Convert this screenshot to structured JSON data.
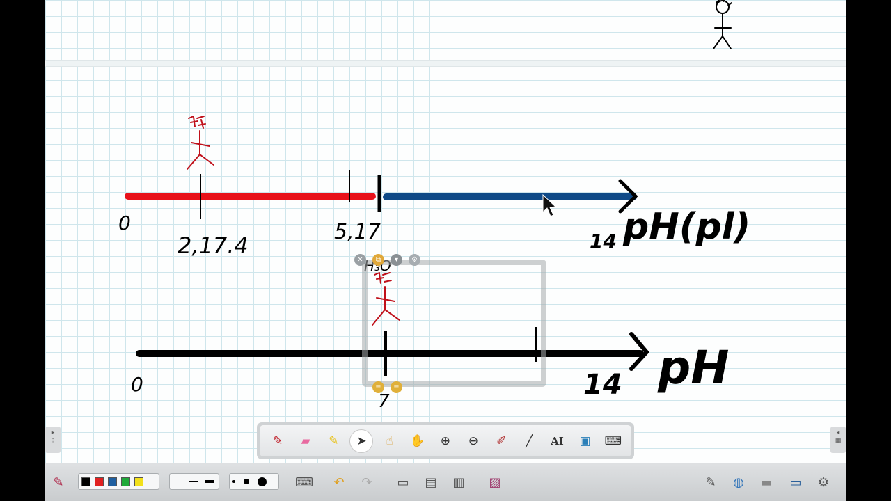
{
  "ink": {
    "lower_figure_labels": [
      "H₃O"
    ],
    "top_axis_labels": [
      "0",
      "2,17.4",
      "5,17",
      "14",
      "pH(pl)"
    ],
    "bottom_axis_labels": [
      "0",
      "7",
      "14",
      "pH"
    ]
  },
  "frame": {
    "buttons": [
      "close-icon",
      "duplicate-icon",
      "menu-down-icon",
      "settings-icon"
    ]
  },
  "floating_toolbar": {
    "tools": [
      "pen",
      "eraser",
      "highlighter",
      "select",
      "magic-pen",
      "hand",
      "zoom-in",
      "zoom-out",
      "laser-pointer",
      "line",
      "text",
      "screen-capture",
      "keyboard"
    ],
    "active": "select",
    "text_tool_glyph": "AI"
  },
  "bottom_bar": {
    "pen_colors": [
      "#000000",
      "#e02020",
      "#1f5fa0",
      "#1faa3a",
      "#f2e01a"
    ],
    "line_widths": [
      "thin",
      "medium",
      "thick"
    ],
    "dot_sizes": [
      "small",
      "medium",
      "large"
    ]
  },
  "colors": {
    "red_axis": "#e8111a",
    "blue_axis": "#0f4a87",
    "ink_black": "#000000",
    "ink_red": "#c0101a"
  }
}
